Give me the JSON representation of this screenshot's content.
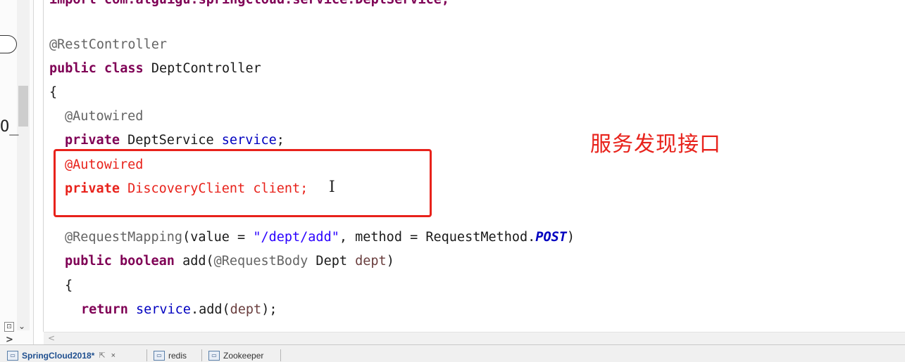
{
  "sidebar": {
    "glyph": "O_",
    "collapse_icon": "⊡",
    "dropdown_arrow": "⌄",
    "expand_arrow": ">"
  },
  "editor": {
    "lines": {
      "import_line": "import com.atguigu.springcloud.service.DeptService;",
      "blank": "",
      "rest_controller": "@RestController",
      "class_kw1": "public",
      "class_kw2": "class",
      "class_name": "DeptController",
      "open_brace": "{",
      "autowired1": "@Autowired",
      "field1_kw": "private",
      "field1_type": "DeptService",
      "field1_name": "service",
      "field1_end": ";",
      "autowired2": "@Autowired",
      "field2_kw": "private",
      "field2_rest": "DiscoveryClient client;",
      "mapping_ann": "@RequestMapping",
      "mapping_open": "(value = ",
      "mapping_path": "\"/dept/add\"",
      "mapping_mid": ", method = RequestMethod.",
      "mapping_const": "POST",
      "mapping_close": ")",
      "method_kw1": "public",
      "method_kw2": "boolean",
      "method_name": "add(",
      "method_param_ann": "@RequestBody",
      "method_param_type": " Dept ",
      "method_param_name": "dept",
      "method_param_close": ")",
      "method_open_brace": "{",
      "return_kw": "return",
      "return_field": "service",
      "return_call": ".add(",
      "return_arg": "dept",
      "return_end": ");"
    },
    "cursor_glyph": "I",
    "annotation_label": "服务发现接口",
    "highlight_color": "#e8221b"
  },
  "hscroll": {
    "left_arrow": "<"
  },
  "tabs": [
    {
      "label": "SpringCloud2018*",
      "icon": "project-icon",
      "active": true,
      "pin": "⇱",
      "close": "×"
    },
    {
      "label": "redis",
      "icon": "project-icon"
    },
    {
      "label": "Zookeeper",
      "icon": "project-icon"
    }
  ],
  "colors": {
    "keyword": "#7f0055",
    "annotation": "#646464",
    "field": "#0000c0",
    "string": "#2a00ff",
    "emphasis_red": "#e8221b"
  }
}
